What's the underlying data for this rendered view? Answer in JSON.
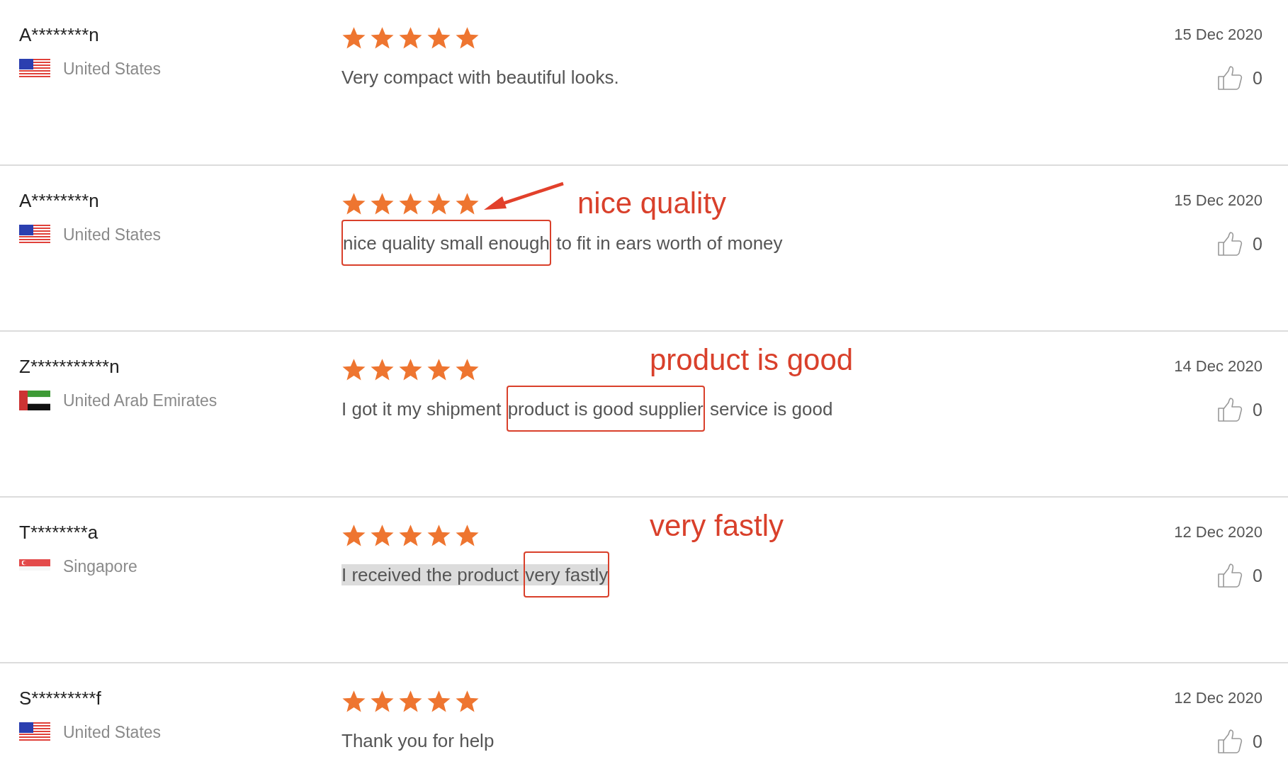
{
  "reviews": [
    {
      "name": "A********n",
      "country": "United States",
      "flag": {
        "kind": "us"
      },
      "stars": 5,
      "date": "15 Dec 2020",
      "likes": "0",
      "segments": [
        {
          "text": "Very compact with beautiful looks.",
          "boxed": false
        }
      ],
      "highlighted": false
    },
    {
      "name": "A********n",
      "country": "United States",
      "flag": {
        "kind": "us"
      },
      "stars": 5,
      "date": "15 Dec 2020",
      "likes": "0",
      "annotation": {
        "label": "nice quality",
        "arrow": true
      },
      "segments": [
        {
          "text": "nice quality small enough",
          "boxed": true
        },
        {
          "text": " to fit in ears worth of money",
          "boxed": false
        }
      ],
      "highlighted": false
    },
    {
      "name": "Z***********n",
      "country": "United Arab Emirates",
      "flag": {
        "kind": "ae"
      },
      "stars": 5,
      "date": "14 Dec 2020",
      "likes": "0",
      "annotation": {
        "label": "product is good",
        "arrow": false
      },
      "segments": [
        {
          "text": "I got it my shipment ",
          "boxed": false
        },
        {
          "text": "product is good supplier",
          "boxed": true
        },
        {
          "text": " service is good",
          "boxed": false
        }
      ],
      "highlighted": false
    },
    {
      "name": "T********a",
      "country": "Singapore",
      "flag": {
        "kind": "sg"
      },
      "stars": 5,
      "date": "12 Dec 2020",
      "likes": "0",
      "annotation": {
        "label": "very fastly",
        "arrow": false
      },
      "segments": [
        {
          "text": "I received the product ",
          "boxed": false
        },
        {
          "text": "very fastly",
          "boxed": true
        }
      ],
      "highlighted": true
    },
    {
      "name": "S*********f",
      "country": "United States",
      "flag": {
        "kind": "us"
      },
      "stars": 5,
      "date": "12 Dec 2020",
      "likes": "0",
      "segments": [
        {
          "text": "Thank you for help",
          "boxed": false
        }
      ],
      "highlighted": false
    }
  ]
}
